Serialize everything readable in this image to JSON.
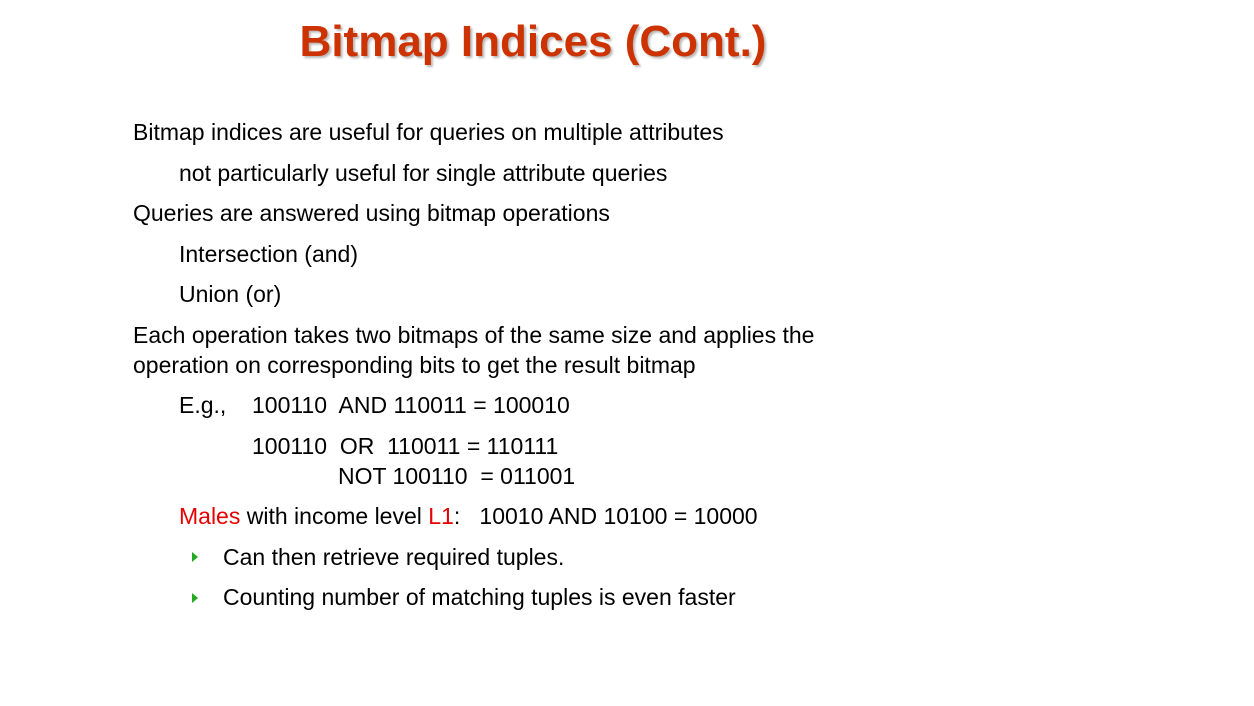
{
  "title": "Bitmap Indices (Cont.)",
  "colors": {
    "title": "#cc3300",
    "highlight": "#e60000",
    "bullet": "#22aa22"
  },
  "content": {
    "p1": "Bitmap indices are useful for queries on multiple attributes",
    "p1_sub1": "not particularly useful for single attribute queries",
    "p2": "Queries are answered using bitmap operations",
    "p2_sub1": "Intersection (and)",
    "p2_sub2": "Union (or)",
    "p3_line1": "Each operation takes two bitmaps of the same size and applies the",
    "p3_line2": "operation on corresponding bits to get the result bitmap",
    "eg_prefix": "E.g.,",
    "eg1": "100110  AND 110011 = 100010",
    "eg2": "100110  OR  110011 = 110111",
    "eg3": "NOT 100110  = 011001",
    "males_word": "Males",
    "males_mid": " with income level ",
    "males_level": "L1",
    "males_rest": ":   10010 AND 10100 = 10000",
    "bullet1": "Can then retrieve required tuples.",
    "bullet2": "Counting number of matching tuples is even faster"
  }
}
